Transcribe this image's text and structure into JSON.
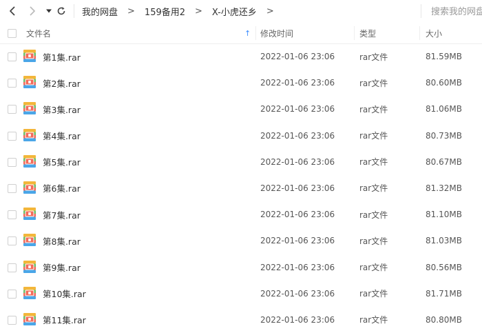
{
  "breadcrumb": [
    "我的网盘",
    "159备用2",
    "X-小虎还乡"
  ],
  "breadcrumb_separator": ">",
  "search": {
    "placeholder": "搜索我的网盘文件"
  },
  "columns": {
    "name": "文件名",
    "modified": "修改时间",
    "type": "类型",
    "size": "大小"
  },
  "sort_indicator": "↑",
  "files": [
    {
      "name": "第1集.rar",
      "modified": "2022-01-06 23:06",
      "type": "rar文件",
      "size": "81.59MB"
    },
    {
      "name": "第2集.rar",
      "modified": "2022-01-06 23:06",
      "type": "rar文件",
      "size": "80.60MB"
    },
    {
      "name": "第3集.rar",
      "modified": "2022-01-06 23:06",
      "type": "rar文件",
      "size": "81.06MB"
    },
    {
      "name": "第4集.rar",
      "modified": "2022-01-06 23:06",
      "type": "rar文件",
      "size": "80.73MB"
    },
    {
      "name": "第5集.rar",
      "modified": "2022-01-06 23:06",
      "type": "rar文件",
      "size": "80.67MB"
    },
    {
      "name": "第6集.rar",
      "modified": "2022-01-06 23:06",
      "type": "rar文件",
      "size": "81.32MB"
    },
    {
      "name": "第7集.rar",
      "modified": "2022-01-06 23:06",
      "type": "rar文件",
      "size": "81.10MB"
    },
    {
      "name": "第8集.rar",
      "modified": "2022-01-06 23:06",
      "type": "rar文件",
      "size": "81.03MB"
    },
    {
      "name": "第9集.rar",
      "modified": "2022-01-06 23:06",
      "type": "rar文件",
      "size": "80.56MB"
    },
    {
      "name": "第10集.rar",
      "modified": "2022-01-06 23:06",
      "type": "rar文件",
      "size": "81.71MB"
    },
    {
      "name": "第11集.rar",
      "modified": "2022-01-06 23:06",
      "type": "rar文件",
      "size": "80.80MB"
    }
  ],
  "icons": {
    "back": "chevron-left-icon",
    "forward": "chevron-right-icon",
    "history": "caret-down-icon",
    "refresh": "refresh-icon",
    "file": "rar-archive-icon"
  },
  "colors": {
    "sort_arrow": "#3b8cff",
    "text": "#333333",
    "muted": "#555555"
  }
}
